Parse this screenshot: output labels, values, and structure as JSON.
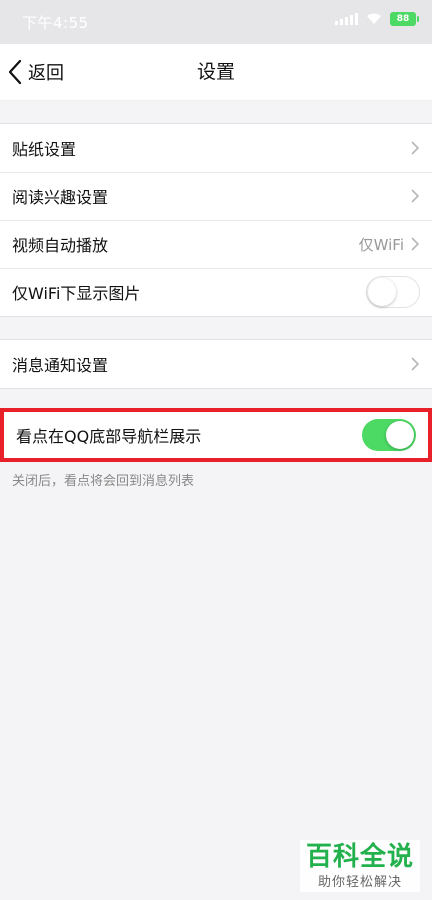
{
  "status_bar": {
    "time": "下午4:55",
    "battery": "88"
  },
  "nav": {
    "back_label": "返回",
    "title": "设置"
  },
  "groups": [
    {
      "items": [
        {
          "label": "贴纸设置"
        },
        {
          "label": "阅读兴趣设置"
        },
        {
          "label": "视频自动播放",
          "value": "仅WiFi"
        },
        {
          "label": "仅WiFi下显示图片",
          "toggle": "off"
        }
      ]
    },
    {
      "items": [
        {
          "label": "消息通知设置"
        }
      ]
    },
    {
      "items": [
        {
          "label": "看点在QQ底部导航栏展示",
          "toggle": "on"
        }
      ]
    }
  ],
  "note": "关闭后，看点将会回到消息列表",
  "watermark": {
    "title": "百科全说",
    "subtitle": "助你轻松解决"
  },
  "colors": {
    "toggle_on": "#4cd964",
    "highlight": "#e8202a",
    "watermark": "#23b14d"
  }
}
